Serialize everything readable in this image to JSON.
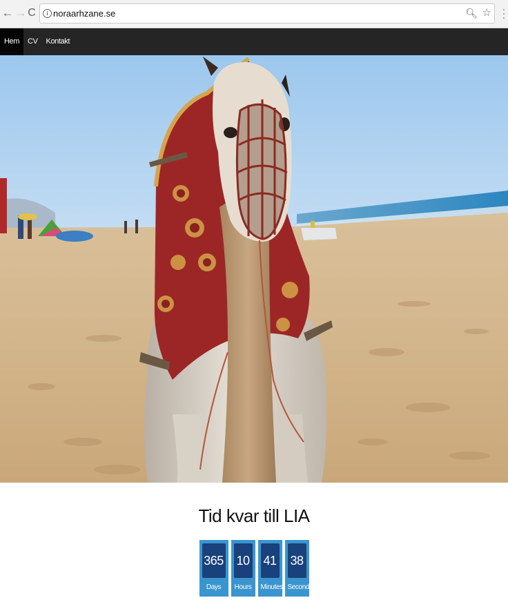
{
  "browser": {
    "url": "noraarhzane.se",
    "back_glyph": "←",
    "forward_glyph": "→",
    "reload_glyph": "C",
    "icons": [
      "back-icon",
      "forward-icon",
      "reload-icon",
      "info-icon",
      "zoom-icon",
      "star-icon",
      "menu-icon"
    ]
  },
  "nav": {
    "items": [
      {
        "label": "Hem",
        "active": true
      },
      {
        "label": "CV",
        "active": false
      },
      {
        "label": "Kontakt",
        "active": false
      }
    ],
    "bg_color": "#252525",
    "active_color": "#050505"
  },
  "hero": {
    "subject": "camel-on-beach-photo"
  },
  "countdown": {
    "title": "Tid kvar till LIA",
    "units": [
      {
        "value": "365",
        "label": "Days"
      },
      {
        "value": "10",
        "label": "Hours"
      },
      {
        "value": "41",
        "label": "Minutes"
      },
      {
        "value": "38",
        "label": "Seconds"
      }
    ],
    "box_color": "#3a95cf",
    "value_bg": "#19417b"
  }
}
